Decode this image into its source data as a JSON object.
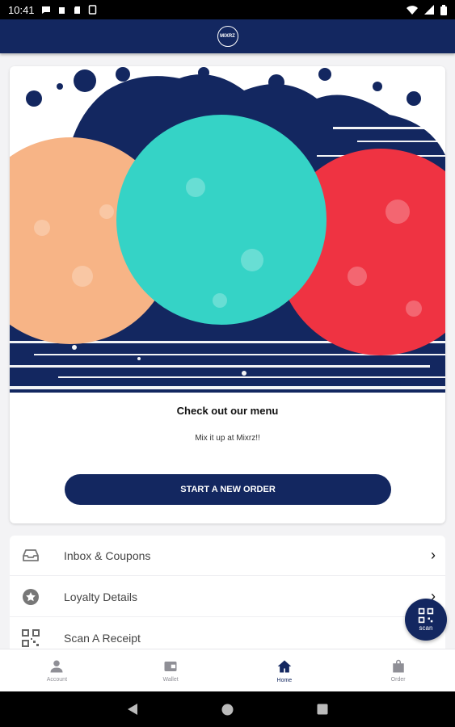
{
  "status_bar": {
    "time": "10:41"
  },
  "header": {
    "logo_text": "MIXRZ"
  },
  "promo": {
    "title": "Check out our menu",
    "subtitle": "Mix it up at Mixrz!!",
    "cta_label": "START A NEW ORDER"
  },
  "menu_list": [
    {
      "label": "Inbox & Coupons",
      "icon": "inbox-icon",
      "chevron": "›"
    },
    {
      "label": "Loyalty Details",
      "icon": "star-badge-icon",
      "chevron": "›"
    },
    {
      "label": "Scan A Receipt",
      "icon": "qr-code-icon",
      "chevron": ""
    }
  ],
  "fab": {
    "label": "scan",
    "icon": "qr-code-icon"
  },
  "bottom_nav": [
    {
      "label": "Account",
      "icon": "person-icon"
    },
    {
      "label": "Wallet",
      "icon": "wallet-icon"
    },
    {
      "label": "Home",
      "icon": "home-icon",
      "active": true
    },
    {
      "label": "Order",
      "icon": "bag-icon"
    }
  ],
  "colors": {
    "brand_navy": "#132760",
    "peach": "#f7b486",
    "teal": "#35d3c6",
    "red": "#ef3342"
  }
}
